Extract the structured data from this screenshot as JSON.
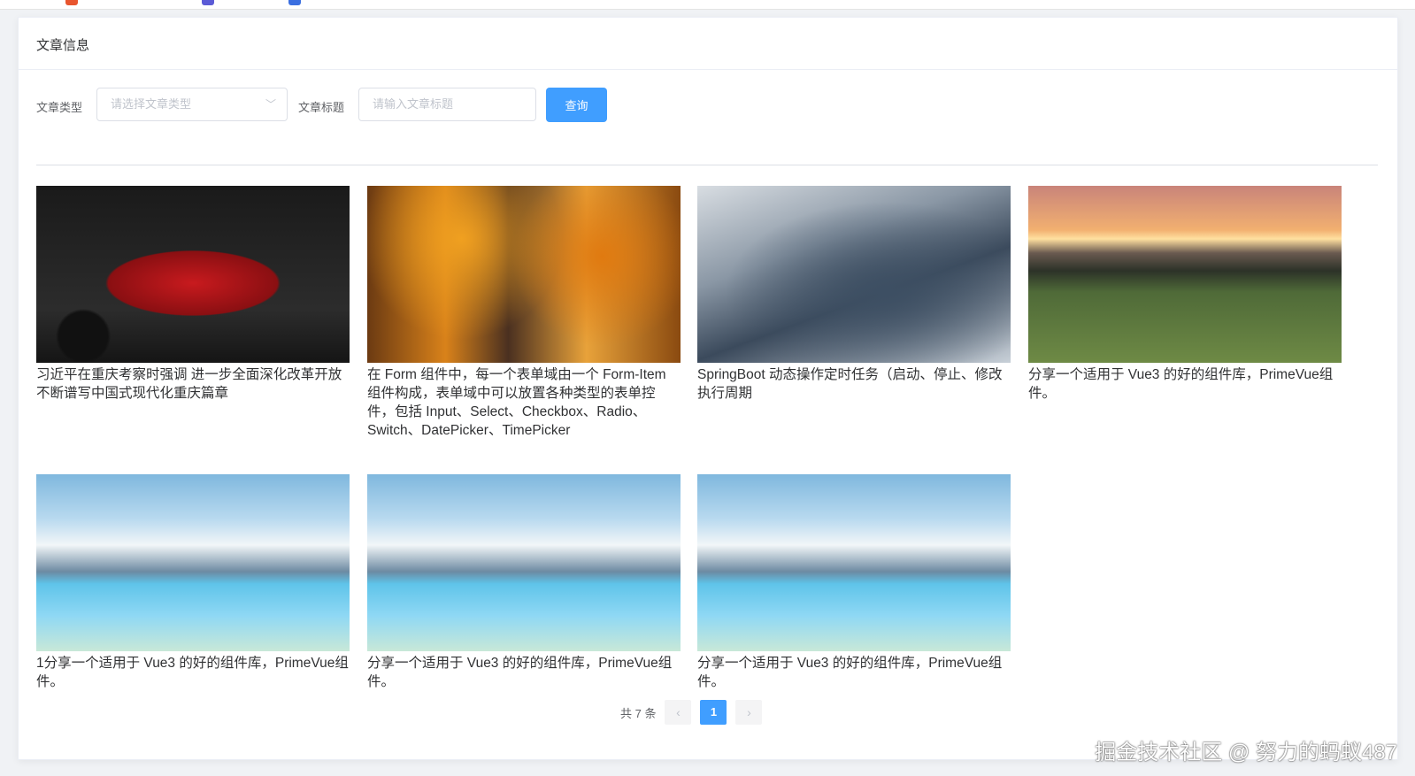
{
  "card": {
    "title": "文章信息"
  },
  "form": {
    "type_label": "文章类型",
    "type_placeholder": "请选择文章类型",
    "title_label": "文章标题",
    "title_placeholder": "请输入文章标题",
    "query_label": "查询"
  },
  "articles": [
    {
      "title": "习近平在重庆考察时强调 进一步全面深化改革开放 不断谱写中国式现代化重庆篇章",
      "image": "red-car"
    },
    {
      "title": "在 Form 组件中，每一个表单域由一个 Form-Item 组件构成，表单域中可以放置各种类型的表单控件，包括 Input、Select、Checkbox、Radio、Switch、DatePicker、TimePicker",
      "image": "autumn-forest"
    },
    {
      "title": "SpringBoot 动态操作定时任务（启动、停止、修改执行周期",
      "image": "snowy-great-wall"
    },
    {
      "title": "分享一个适用于 Vue3 的好的组件库，PrimeVue组件。",
      "image": "sunset-field-path"
    },
    {
      "title": "1分享一个适用于 Vue3 的好的组件库，PrimeVue组件。",
      "image": "winter-lake"
    },
    {
      "title": "分享一个适用于 Vue3 的好的组件库，PrimeVue组件。",
      "image": "winter-lake"
    },
    {
      "title": "分享一个适用于 Vue3 的好的组件库，PrimeVue组件。",
      "image": "winter-lake"
    }
  ],
  "pagination": {
    "total": "共 7 条",
    "current": "1",
    "prev": "‹",
    "next": "›"
  },
  "watermark": "掘金技术社区 @ 努力的蚂蚁487",
  "colors": {
    "primary": "#409eff"
  }
}
